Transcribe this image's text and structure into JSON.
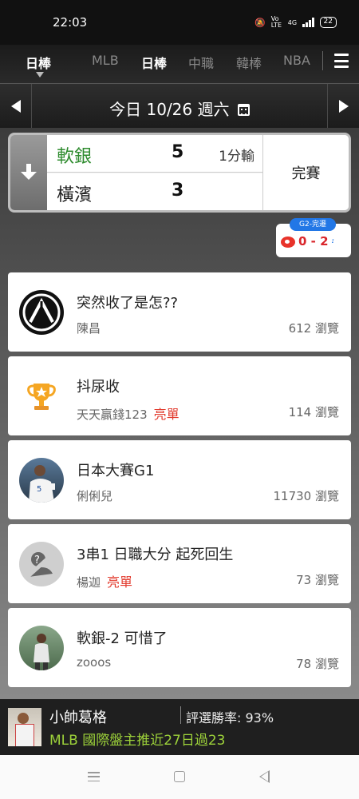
{
  "status_bar": {
    "time": "22:03",
    "network": "4G",
    "volte": "Vo LTE",
    "battery": "22"
  },
  "league_bar": {
    "current": "日棒",
    "tabs": [
      {
        "label": "MLB",
        "active": false
      },
      {
        "label": "日棒",
        "active": true
      },
      {
        "label": "中職",
        "active": false
      },
      {
        "label": "韓棒",
        "active": false
      },
      {
        "label": "NBA",
        "active": false
      }
    ],
    "menu_icon": "hamburger-menu-icon"
  },
  "date_bar": {
    "label": "今日 10/26 週六",
    "prev_icon": "arrow-left-icon",
    "next_icon": "arrow-right-icon",
    "calendar_icon": "calendar-icon"
  },
  "game": {
    "team1": {
      "name": "軟銀",
      "score": "5",
      "note": "1分輸"
    },
    "team2": {
      "name": "橫濱",
      "score": "3"
    },
    "status": "完賽",
    "winner_color": "#2e8b2e"
  },
  "series": {
    "tag": "G2-完遷",
    "score": "0 - 2"
  },
  "posts": [
    {
      "title": "突然收了是怎??",
      "author": "陳昌",
      "hot": "",
      "views": "612 瀏覽",
      "avatar": "linkin-park-logo"
    },
    {
      "title": "抖尿收",
      "author": "天天贏錢123",
      "hot": "亮單",
      "views": "114 瀏覽",
      "avatar": "trophy-icon"
    },
    {
      "title": "日本大賽G1",
      "author": "俐俐兒",
      "hot": "",
      "views": "11730 瀏覽",
      "avatar": "player-photo"
    },
    {
      "title": "3串1 日職大分 起死回生",
      "author": "楊迦",
      "hot": "亮單",
      "views": "73 瀏覽",
      "avatar": "question-avatar"
    },
    {
      "title": "軟銀-2 可惜了",
      "author": "zooos",
      "hot": "",
      "views": "78 瀏覽",
      "avatar": "player-photo-2"
    }
  ],
  "promo": {
    "name": "小帥葛格",
    "rate": "評選勝率: 93%",
    "desc": "MLB 國際盤主推近27日過23"
  },
  "colors": {
    "accent_green": "#2e8b2e",
    "hot_red": "#e23b2e",
    "promo_green": "#9dd23a",
    "series_blue": "#2277e6"
  }
}
